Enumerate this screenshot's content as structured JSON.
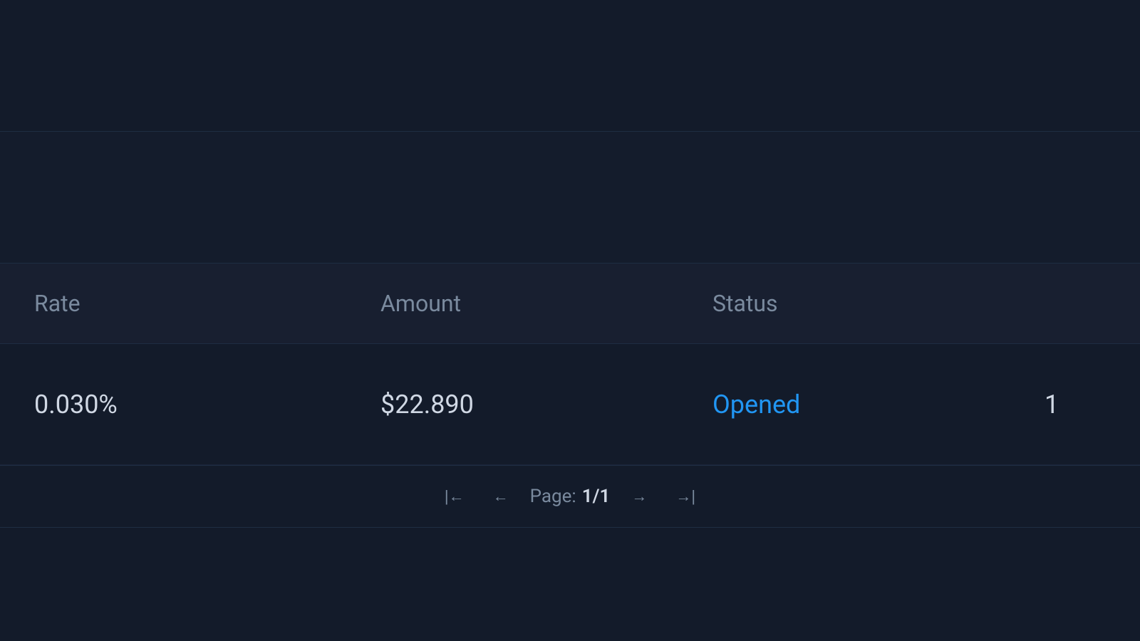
{
  "header": {
    "columns": {
      "rate": "Rate",
      "amount": "Amount",
      "status": "Status",
      "extra": ""
    }
  },
  "table": {
    "rows": [
      {
        "rate": "0.030%",
        "amount": "$22.890",
        "status": "Opened",
        "extra": "1"
      }
    ]
  },
  "pagination": {
    "label": "Page:",
    "current": "1/1",
    "first_btn": "|←",
    "prev_btn": "←",
    "next_btn": "→",
    "last_btn": "→|"
  },
  "colors": {
    "status_opened": "#2196f3",
    "header_bg": "#181f30",
    "row_bg": "#131b2a",
    "text_muted": "#7a8a9e",
    "text_primary": "#d0d8e4"
  }
}
